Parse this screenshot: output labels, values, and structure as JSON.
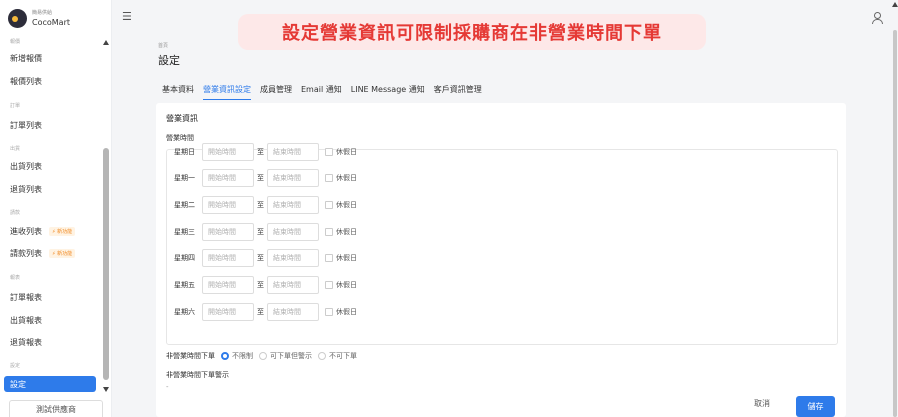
{
  "brand": {
    "subtitle": "簡易供給",
    "name": "CocoMart"
  },
  "sidebar": {
    "groups": [
      {
        "key": "g0",
        "label": "報價"
      },
      {
        "key": "g1",
        "label": "訂單"
      },
      {
        "key": "g2",
        "label": "出貨"
      },
      {
        "key": "g3",
        "label": "請款"
      },
      {
        "key": "g4",
        "label": "報表"
      },
      {
        "key": "g5",
        "label": "設定"
      }
    ],
    "items": [
      {
        "label": "新增報價"
      },
      {
        "label": "報價列表"
      },
      {
        "label": "訂單列表"
      },
      {
        "label": "出貨列表"
      },
      {
        "label": "退貨列表"
      },
      {
        "label": "進收列表",
        "badge": "新功能"
      },
      {
        "label": "請款列表",
        "badge": "新功能"
      },
      {
        "label": "訂單報表"
      },
      {
        "label": "出貨報表"
      },
      {
        "label": "退貨報表"
      },
      {
        "label": "設定"
      }
    ],
    "vendor_button": "測試供應商"
  },
  "topbar": {
    "menu_icon": "☰"
  },
  "banner": "設定營業資訊可限制採購商在非營業時間下單",
  "breadcrumb": "首頁",
  "page_title": "設定",
  "tabs": [
    "基本資料",
    "營業資訊設定",
    "成員管理",
    "Email 通知",
    "LINE Message 通知",
    "客戶資訊管理"
  ],
  "active_tab_index": 1,
  "section_title": "營業資訊",
  "hours_label": "營業時間",
  "days": [
    "星期日",
    "星期一",
    "星期二",
    "星期三",
    "星期四",
    "星期五",
    "星期六"
  ],
  "start_placeholder": "開始時間",
  "end_placeholder": "結束時間",
  "to_text": "至",
  "holiday_label": "休假日",
  "order_limit": {
    "label": "非營業時間下單",
    "options": [
      "不限制",
      "可下單但警示",
      "不可下單"
    ],
    "selected_index": 0
  },
  "warning_label": "非營業時間下單警示",
  "warning_value": "-",
  "buttons": {
    "cancel": "取消",
    "save": "儲存"
  },
  "colors": {
    "accent": "#2e7bea",
    "banner_text": "#e53935",
    "banner_bg": "#fde8e8",
    "badge": "#f08a24"
  }
}
